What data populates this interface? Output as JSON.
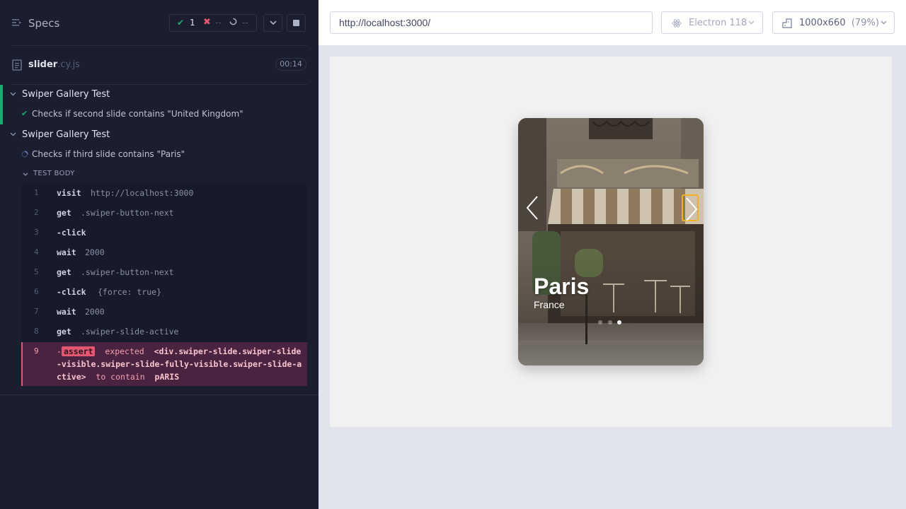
{
  "reporter": {
    "header": {
      "title": "Specs",
      "passed": "1",
      "failed": "--",
      "pending": "--"
    },
    "spec": {
      "name": "slider",
      "ext": ".cy.js",
      "duration": "00:14"
    },
    "suites": [
      {
        "title": "Swiper Gallery Test",
        "test": "Checks if second slide contains \"United Kingdom\"",
        "status": "passed"
      },
      {
        "title": "Swiper Gallery Test",
        "test": "Checks if third slide contains \"Paris\"",
        "status": "running"
      }
    ],
    "test_body_label": "TEST BODY",
    "commands": [
      {
        "num": "1",
        "name": "visit",
        "arg": "http://localhost:3000"
      },
      {
        "num": "2",
        "name": "get",
        "arg": ".swiper-button-next"
      },
      {
        "num": "3",
        "name": "-click",
        "arg": ""
      },
      {
        "num": "4",
        "name": "wait",
        "arg": "2000"
      },
      {
        "num": "5",
        "name": "get",
        "arg": ".swiper-button-next"
      },
      {
        "num": "6",
        "name": "-click",
        "arg": "{force: true}"
      },
      {
        "num": "7",
        "name": "wait",
        "arg": "2000"
      },
      {
        "num": "8",
        "name": "get",
        "arg": ".swiper-slide-active"
      }
    ],
    "error_command": {
      "num": "9",
      "prefix": "-",
      "badge": "assert",
      "expected": "expected",
      "subject": "<div.swiper-slide.swiper-slide-visible.swiper-slide-fully-visible.swiper-slide-active>",
      "to_contain": "to contain",
      "value": "pARIS"
    }
  },
  "aut": {
    "url": "http://localhost:3000/",
    "browser": "Electron 118",
    "viewport": "1000x660",
    "scale": "(79%)",
    "slide": {
      "title": "Paris",
      "subtitle": "France",
      "active_dot": 2,
      "dot_count": 3
    }
  },
  "colors": {
    "pass": "#1fa971",
    "fail": "#e45770",
    "accent": "#f2b21f"
  },
  "icons": [
    "list-icon",
    "check-icon",
    "x-icon",
    "spinner-icon",
    "chevron-down-icon",
    "stop-icon",
    "file-icon",
    "electron-icon",
    "ruler-icon",
    "chevron-left-icon",
    "chevron-right-icon"
  ]
}
